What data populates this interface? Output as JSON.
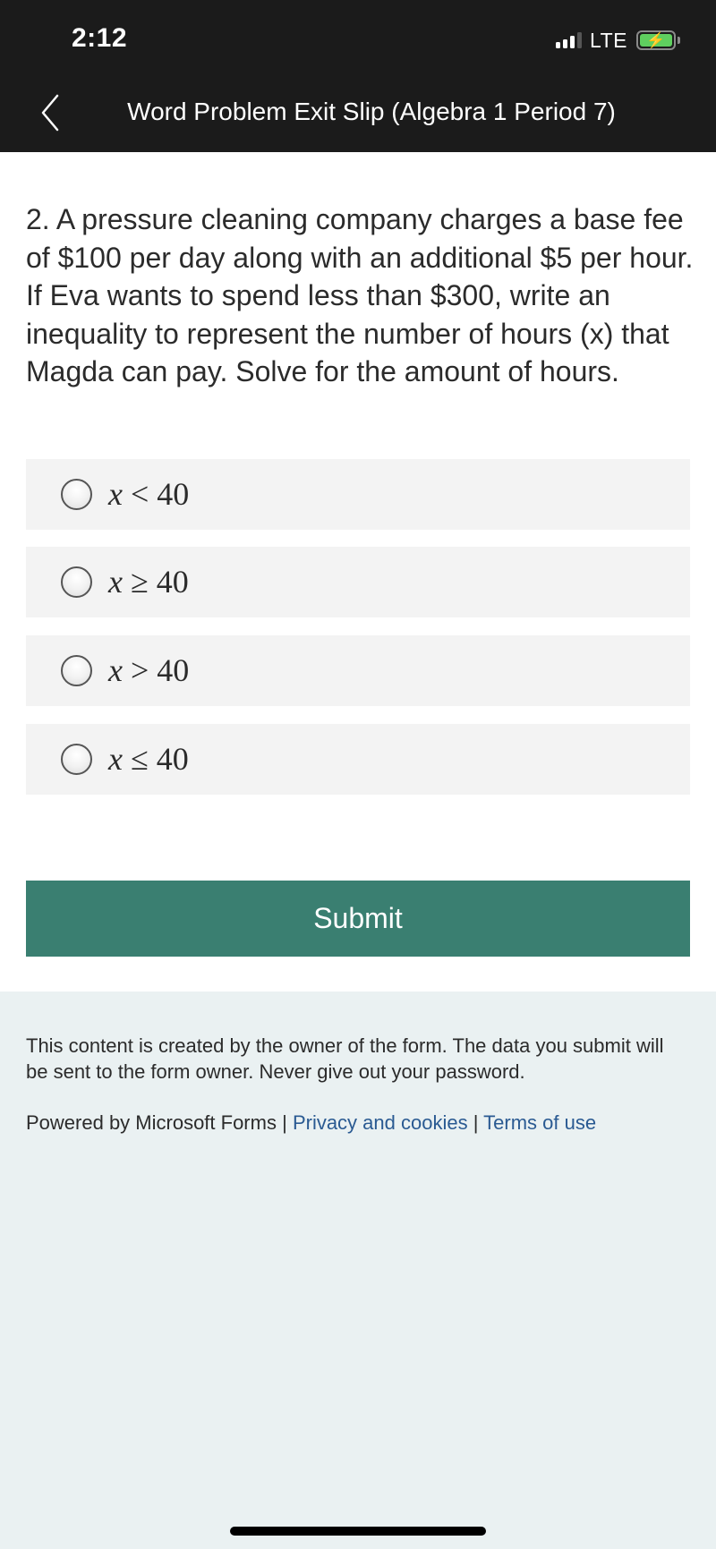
{
  "status_bar": {
    "time": "2:12",
    "network": "LTE",
    "signal_bars": 3,
    "signal_bars_max": 4,
    "battery_charging": true,
    "battery_color": "#5fcf5f"
  },
  "nav": {
    "back_icon": "chevron-left-icon",
    "title": "Word Problem Exit Slip (Algebra 1 Period 7)"
  },
  "question": {
    "text": "2. A pressure cleaning company charges a base fee of $100 per day along with an additional $5 per hour. If Eva wants to spend less than $300, write an inequality to represent the number of hours (x) that Magda can pay. Solve for the amount of hours."
  },
  "options": [
    {
      "variable": "x",
      "relation": "<",
      "value": "40",
      "selected": false
    },
    {
      "variable": "x",
      "relation": "≥",
      "value": "40",
      "selected": false
    },
    {
      "variable": "x",
      "relation": ">",
      "value": "40",
      "selected": false
    },
    {
      "variable": "x",
      "relation": "≤",
      "value": "40",
      "selected": false
    }
  ],
  "submit": {
    "label": "Submit",
    "color": "#3a7f71"
  },
  "footer": {
    "disclaimer": "This content is created by the owner of the form. The data you submit will be sent to the form owner. Never give out your password.",
    "powered_by": "Powered by Microsoft Forms",
    "separator": "|",
    "privacy_link": "Privacy and cookies",
    "terms_link": "Terms of use",
    "link_color": "#2a5a92"
  }
}
